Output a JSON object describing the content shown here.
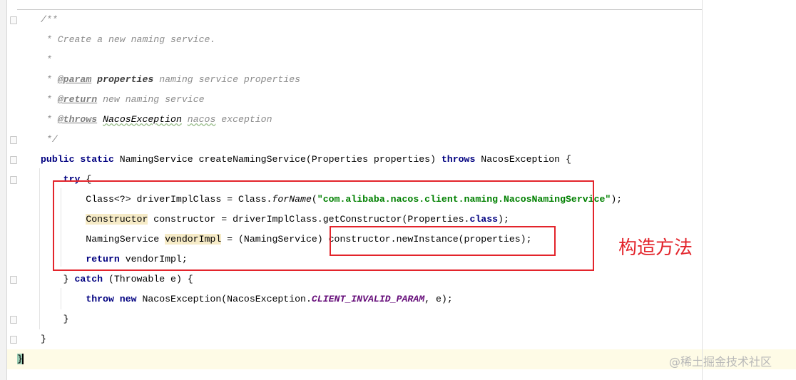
{
  "editor": {
    "lines": [
      [
        {
          "t": "/**",
          "c": "cm"
        }
      ],
      [
        {
          "t": " * Create a new naming service.",
          "c": "cm"
        }
      ],
      [
        {
          "t": " *",
          "c": "cm"
        }
      ],
      [
        {
          "t": " * ",
          "c": "cm"
        },
        {
          "t": "@param",
          "c": "tag"
        },
        {
          "t": " ",
          "c": "cm"
        },
        {
          "t": "properties",
          "c": "cmb"
        },
        {
          "t": " naming service properties",
          "c": "cm"
        }
      ],
      [
        {
          "t": " * ",
          "c": "cm"
        },
        {
          "t": "@return",
          "c": "tag"
        },
        {
          "t": " new naming service",
          "c": "cm"
        }
      ],
      [
        {
          "t": " * ",
          "c": "cm"
        },
        {
          "t": "@throws",
          "c": "tag"
        },
        {
          "t": " ",
          "c": "cm"
        },
        {
          "t": "NacosException",
          "c": "cmb2 sq"
        },
        {
          "t": " ",
          "c": "cm"
        },
        {
          "t": "nacos",
          "c": "cm sq"
        },
        {
          "t": " exception",
          "c": "cm"
        }
      ],
      [
        {
          "t": " */",
          "c": "cm"
        }
      ],
      [
        {
          "t": "public static",
          "c": "kw"
        },
        {
          "t": " NamingService createNamingService(Properties properties) ",
          "c": ""
        },
        {
          "t": "throws",
          "c": "kw"
        },
        {
          "t": " NacosException {",
          "c": ""
        }
      ],
      [
        {
          "t": "    ",
          "c": ""
        },
        {
          "t": "try",
          "c": "kw"
        },
        {
          "t": " {",
          "c": ""
        }
      ],
      [
        {
          "t": "        Class<?> driverImplClass = Class.",
          "c": ""
        },
        {
          "t": "forName",
          "c": "it"
        },
        {
          "t": "(",
          "c": ""
        },
        {
          "t": "\"com.alibaba.nacos.client.naming.NacosNamingService\"",
          "c": "str"
        },
        {
          "t": ");",
          "c": ""
        }
      ],
      [
        {
          "t": "        ",
          "c": ""
        },
        {
          "t": "Constructor",
          "c": "hl"
        },
        {
          "t": " constructor = driverImplClass.getConstructor(Properties.",
          "c": ""
        },
        {
          "t": "class",
          "c": "kw"
        },
        {
          "t": ");",
          "c": ""
        }
      ],
      [
        {
          "t": "        NamingService ",
          "c": ""
        },
        {
          "t": "vendorImpl",
          "c": "hl"
        },
        {
          "t": " = (NamingService) constructor.newInstance(properties);",
          "c": ""
        }
      ],
      [
        {
          "t": "        ",
          "c": ""
        },
        {
          "t": "return",
          "c": "kw"
        },
        {
          "t": " vendorImpl;",
          "c": ""
        }
      ],
      [
        {
          "t": "    } ",
          "c": ""
        },
        {
          "t": "catch",
          "c": "kw"
        },
        {
          "t": " (Throwable e) {",
          "c": ""
        }
      ],
      [
        {
          "t": "        ",
          "c": ""
        },
        {
          "t": "throw new",
          "c": "kw"
        },
        {
          "t": " NacosException(NacosException.",
          "c": ""
        },
        {
          "t": "CLIENT_INVALID_PARAM",
          "c": "sf"
        },
        {
          "t": ", e);",
          "c": ""
        }
      ],
      [
        {
          "t": "    }",
          "c": ""
        }
      ],
      [
        {
          "t": "}",
          "c": ""
        }
      ]
    ],
    "last_line": "}"
  },
  "annotation": {
    "label": "构造方法",
    "color": "#e3242b"
  },
  "watermark": "@稀土掘金技术社区"
}
